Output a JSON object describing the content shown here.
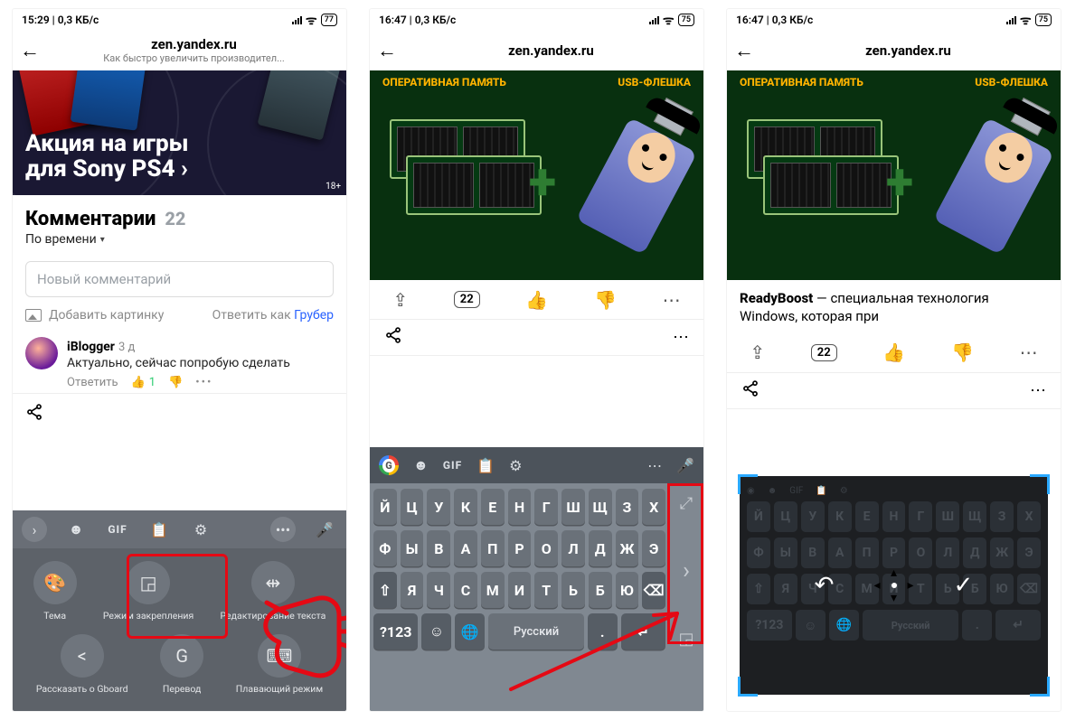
{
  "phones": [
    {
      "status": {
        "time": "15:29",
        "net": "0,3 КБ/с",
        "battery": "77"
      },
      "url": "zen.yandex.ru",
      "subtitle": "Как быстро увеличить производител...",
      "hero": {
        "title_line1": "Акция на игры",
        "title_line2": "для Sony PS4 ›",
        "age_badge": "18+"
      },
      "comments": {
        "header": "Комментарии",
        "count": "22",
        "sort": "По времени",
        "input_placeholder": "Новый комментарий",
        "add_image": "Добавить картинку",
        "answer_as_prefix": "Ответить как",
        "answer_as_name": "Грубер",
        "items": [
          {
            "author": "iBlogger",
            "age": "3 д",
            "text": "Актуально, сейчас попробую сделать",
            "reply": "Ответить",
            "likes": "1"
          }
        ]
      },
      "gboard_top": {
        "gif": "GIF"
      },
      "gboard_cells_row1": [
        {
          "icon": "🎨",
          "label": "Тема"
        },
        {
          "icon": "◲",
          "label": "Режим закрепления"
        },
        {
          "icon": "⇹",
          "label": "Редактирование текста"
        }
      ],
      "gboard_cells_row2": [
        {
          "icon": "<",
          "label": "Рассказать о Gboard"
        },
        {
          "icon": "G",
          "label": "Перевод"
        },
        {
          "icon": "⌨",
          "label": "Плавающий режим"
        }
      ]
    },
    {
      "status": {
        "time": "16:47",
        "net": "0,3 КБ/с",
        "battery": "75"
      },
      "url": "zen.yandex.ru",
      "image_caps": {
        "left": "ОПЕРАТИВНАЯ ПАМЯТЬ",
        "right": "USB-ФЛЕШКА"
      },
      "actionrow": {
        "count": "22"
      },
      "keyboard": {
        "rows": [
          [
            "Й",
            "Ц",
            "У",
            "К",
            "Е",
            "Н",
            "Г",
            "Ш",
            "Щ",
            "З",
            "Х"
          ],
          [
            "Ф",
            "Ы",
            "В",
            "А",
            "П",
            "Р",
            "О",
            "Л",
            "Д",
            "Ж",
            "Э"
          ],
          [
            "⇧",
            "Я",
            "Ч",
            "С",
            "М",
            "И",
            "Т",
            "Ь",
            "Б",
            "Ю",
            "⌫"
          ]
        ],
        "bottom": {
          "num": "?123",
          "emoji": "☺",
          "globe": "🌐",
          "space": "Русский",
          "dot": ".",
          "enter": "↵"
        }
      }
    },
    {
      "status": {
        "time": "16:47",
        "net": "0,3 КБ/с",
        "battery": "75"
      },
      "url": "zen.yandex.ru",
      "image_caps": {
        "left": "ОПЕРАТИВНАЯ ПАМЯТЬ",
        "right": "USB-ФЛЕШКА"
      },
      "readyboost": {
        "bold": "ReadyBoost",
        "rest": " — специальная технология Windows, которая при"
      },
      "actionrow": {
        "count": "22"
      },
      "ghost_rows": [
        [
          "Й",
          "Ц",
          "У",
          "К",
          "Е",
          "Н",
          "Г",
          "Ш",
          "Щ",
          "З",
          "Х"
        ],
        [
          "Ф",
          "Ы",
          "В",
          "А",
          "П",
          "Р",
          "О",
          "Л",
          "Д",
          "Ж",
          "Э"
        ],
        [
          "⇧",
          "Я",
          "Ч",
          "С",
          "М",
          "И",
          "Т",
          "Ь",
          "Б",
          "Ю",
          "⌫"
        ]
      ],
      "ghost_bottom": {
        "num": "?123",
        "emoji": "☺",
        "globe": "🌐",
        "space": "Русский",
        "dot": ".",
        "enter": "↵"
      },
      "toolbar_hint": "GIF"
    }
  ]
}
